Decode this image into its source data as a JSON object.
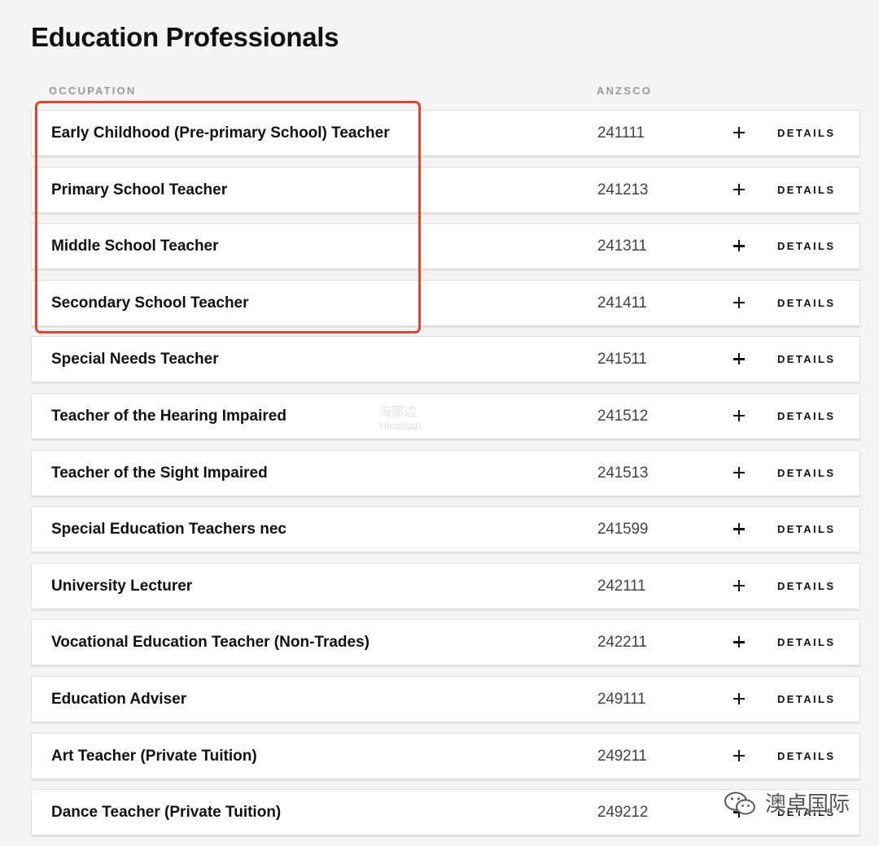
{
  "page": {
    "title": "Education Professionals"
  },
  "columns": {
    "occupation": "OCCUPATION",
    "anzsco": "ANZSCO"
  },
  "rows": [
    {
      "occupation": "Early Childhood (Pre-primary School) Teacher",
      "anzsco": "241111",
      "details_label": "DETAILS"
    },
    {
      "occupation": "Primary School Teacher",
      "anzsco": "241213",
      "details_label": "DETAILS"
    },
    {
      "occupation": "Middle School Teacher",
      "anzsco": "241311",
      "details_label": "DETAILS"
    },
    {
      "occupation": "Secondary School Teacher",
      "anzsco": "241411",
      "details_label": "DETAILS"
    },
    {
      "occupation": "Special Needs Teacher",
      "anzsco": "241511",
      "details_label": "DETAILS"
    },
    {
      "occupation": "Teacher of the Hearing Impaired",
      "anzsco": "241512",
      "details_label": "DETAILS"
    },
    {
      "occupation": "Teacher of the Sight Impaired",
      "anzsco": "241513",
      "details_label": "DETAILS"
    },
    {
      "occupation": "Special Education Teachers nec",
      "anzsco": "241599",
      "details_label": "DETAILS"
    },
    {
      "occupation": "University Lecturer",
      "anzsco": "242111",
      "details_label": "DETAILS"
    },
    {
      "occupation": "Vocational Education Teacher (Non-Trades)",
      "anzsco": "242211",
      "details_label": "DETAILS"
    },
    {
      "occupation": "Education Adviser",
      "anzsco": "249111",
      "details_label": "DETAILS"
    },
    {
      "occupation": "Art Teacher (Private Tuition)",
      "anzsco": "249211",
      "details_label": "DETAILS"
    },
    {
      "occupation": "Dance Teacher (Private Tuition)",
      "anzsco": "249212",
      "details_label": "DETAILS"
    }
  ],
  "icons": {
    "expand": "plus-icon",
    "wechat": "wechat-icon"
  },
  "colors": {
    "highlight_box": "#e5432f",
    "background": "#f4f4f4"
  },
  "watermarks": {
    "center_primary": "海那边",
    "center_secondary": "Hinabian",
    "brand": "澳卓国际"
  }
}
